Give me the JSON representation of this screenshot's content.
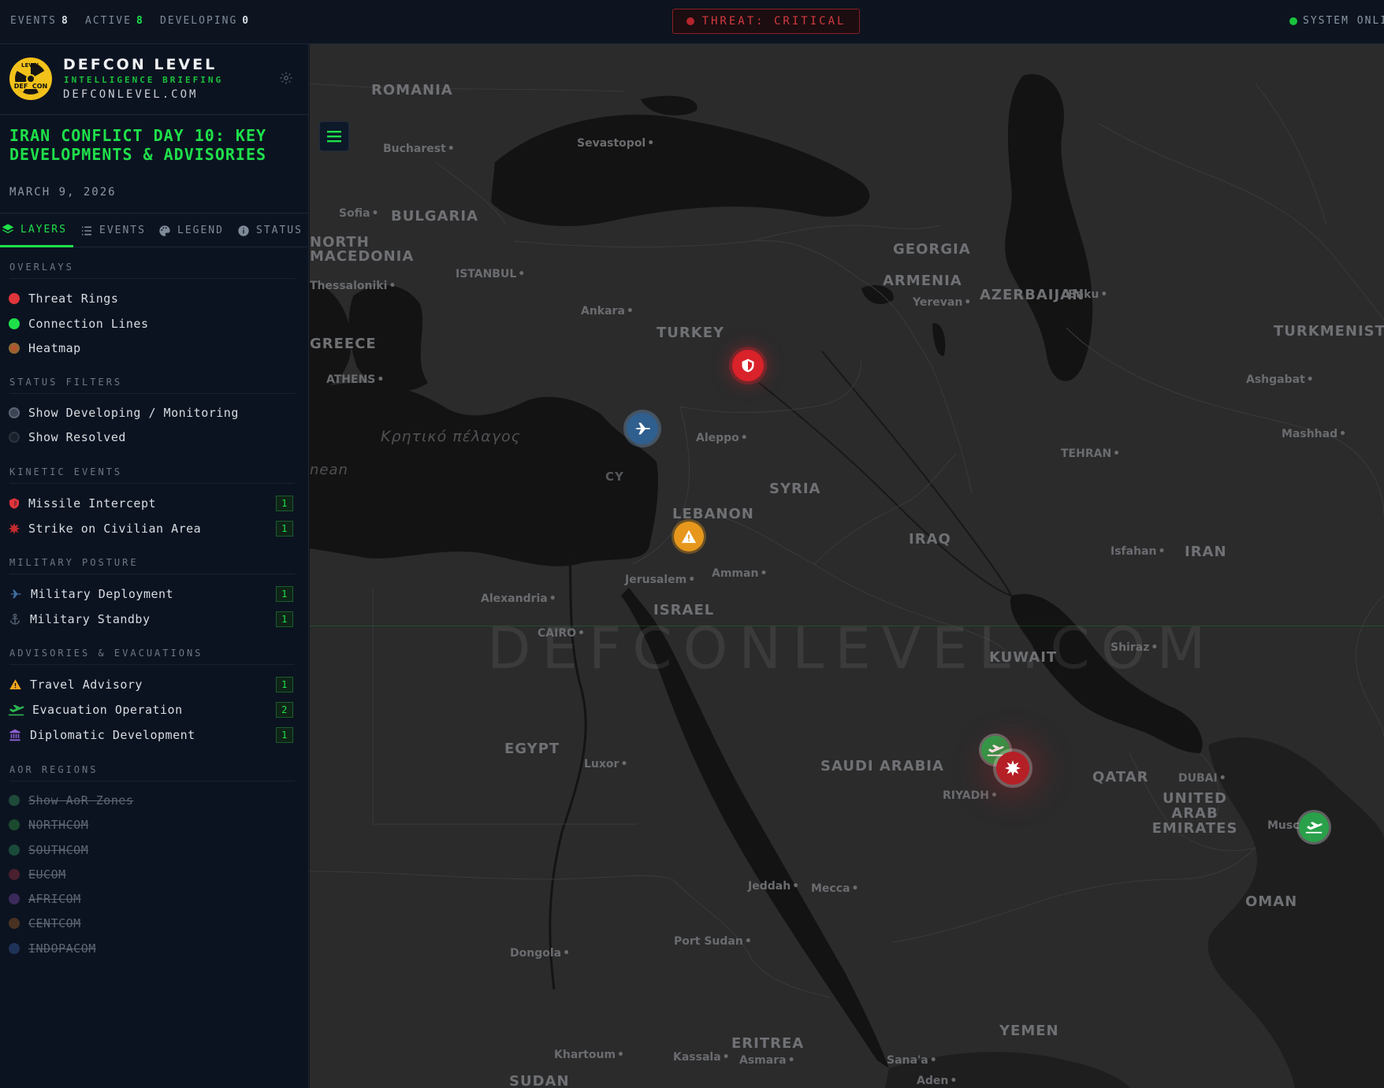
{
  "topbar": {
    "events_label": "EVENTS",
    "events_value": "8",
    "active_label": "ACTIVE",
    "active_value": "8",
    "developing_label": "DEVELOPING",
    "developing_value": "0",
    "threat_text": "THREAT: CRITICAL",
    "system_text": "SYSTEM ONLINE",
    "colors": {
      "threat": "#d33a3f",
      "online": "#19c23c",
      "accent": "#1ee04a"
    }
  },
  "brand": {
    "logo_top": "LEVEL",
    "logo_bottom": "DEF  CON",
    "title": "DEFCON LEVEL",
    "subtitle": "INTELLIGENCE BRIEFING",
    "url": "DEFCONLEVEL.COM"
  },
  "briefing": {
    "title": "IRAN CONFLICT DAY 10: KEY DEVELOPMENTS & ADVISORIES",
    "date": "MARCH 9, 2026"
  },
  "tabs": [
    {
      "label": "LAYERS",
      "icon": "layers-icon",
      "active": true
    },
    {
      "label": "EVENTS",
      "icon": "list-icon",
      "active": false
    },
    {
      "label": "LEGEND",
      "icon": "palette-icon",
      "active": false
    },
    {
      "label": "STATUS",
      "icon": "info-icon",
      "active": false
    }
  ],
  "overlays": {
    "heading": "OVERLAYS",
    "items": [
      {
        "label": "Threat Rings",
        "color": "#e0353b"
      },
      {
        "label": "Connection Lines",
        "color": "#1ee04a"
      },
      {
        "label": "Heatmap",
        "color": "#8a7a4a"
      }
    ]
  },
  "status_filters": {
    "heading": "STATUS FILTERS",
    "items": [
      {
        "label": "Show Developing / Monitoring"
      },
      {
        "label": "Show Resolved"
      }
    ]
  },
  "kinetic": {
    "heading": "KINETIC EVENTS",
    "items": [
      {
        "label": "Missile Intercept",
        "count": "1",
        "icon": "shield-icon",
        "color": "#e0353b"
      },
      {
        "label": "Strike on Civilian Area",
        "count": "1",
        "icon": "burst-icon",
        "color": "#c52a2f"
      }
    ]
  },
  "military": {
    "heading": "MILITARY POSTURE",
    "items": [
      {
        "label": "Military Deployment",
        "count": "1",
        "icon": "jet-icon",
        "color": "#3f6fa0"
      },
      {
        "label": "Military Standby",
        "count": "1",
        "icon": "anchor-icon",
        "color": "#4d5a6b"
      }
    ]
  },
  "advisories": {
    "heading": "ADVISORIES & EVACUATIONS",
    "items": [
      {
        "label": "Travel Advisory",
        "count": "1",
        "icon": "warning-icon",
        "color": "#f0a51c"
      },
      {
        "label": "Evacuation Operation",
        "count": "2",
        "icon": "plane-departure-icon",
        "color": "#2bb34f"
      },
      {
        "label": "Diplomatic Development",
        "count": "1",
        "icon": "bank-icon",
        "color": "#8b5fd0"
      }
    ]
  },
  "aor": {
    "heading": "AOR REGIONS",
    "items": [
      {
        "label": "Show AoR Zones",
        "color": "#1e4a3a"
      },
      {
        "label": "NORTHCOM",
        "color": "#1a4a2e"
      },
      {
        "label": "SOUTHCOM",
        "color": "#1a4a3a"
      },
      {
        "label": "EUCOM",
        "color": "#4a1f2e"
      },
      {
        "label": "AFRICOM",
        "color": "#3a2a5a"
      },
      {
        "label": "CENTCOM",
        "color": "#4a3222"
      },
      {
        "label": "INDOPACOM",
        "color": "#1f3358"
      }
    ]
  },
  "map": {
    "watermark": "DEFCONLEVEL.COM",
    "countries": [
      "ROMANIA",
      "BULGARIA",
      "NORTH MACEDONIA",
      "GREECE",
      "TURKEY",
      "GEORGIA",
      "ARMENIA",
      "AZERBAIJAN",
      "TURKMENISTAN",
      "SYRIA",
      "LEBANON",
      "ISRAEL",
      "IRAQ",
      "IRAN",
      "KUWAIT",
      "EGYPT",
      "SAUDI ARABIA",
      "QATAR",
      "UNITED ARAB EMIRATES",
      "OMAN",
      "YEMEN",
      "ERITREA",
      "SUDAN"
    ],
    "cities": [
      "Bucharest",
      "Sevastopol",
      "Sofia",
      "ISTANBUL",
      "Thessaloniki",
      "Ankara",
      "ATHENS",
      "Yerevan",
      "Baku",
      "Ashgabat",
      "Mashhad",
      "TEHRAN",
      "Aleppo",
      "Isfahan",
      "Jerusalem",
      "Amman",
      "Alexandria",
      "CAIRO",
      "Shiraz",
      "Luxor",
      "RIYADH",
      "DUBAI",
      "Muscat",
      "Jeddah",
      "Mecca",
      "Port Sudan",
      "Dongola",
      "Khartoum",
      "Kassala",
      "Asmara",
      "Sana'a",
      "Aden"
    ],
    "sea_labels": [
      "Κρητικό πέλαγος",
      "nean",
      "CY"
    ]
  }
}
